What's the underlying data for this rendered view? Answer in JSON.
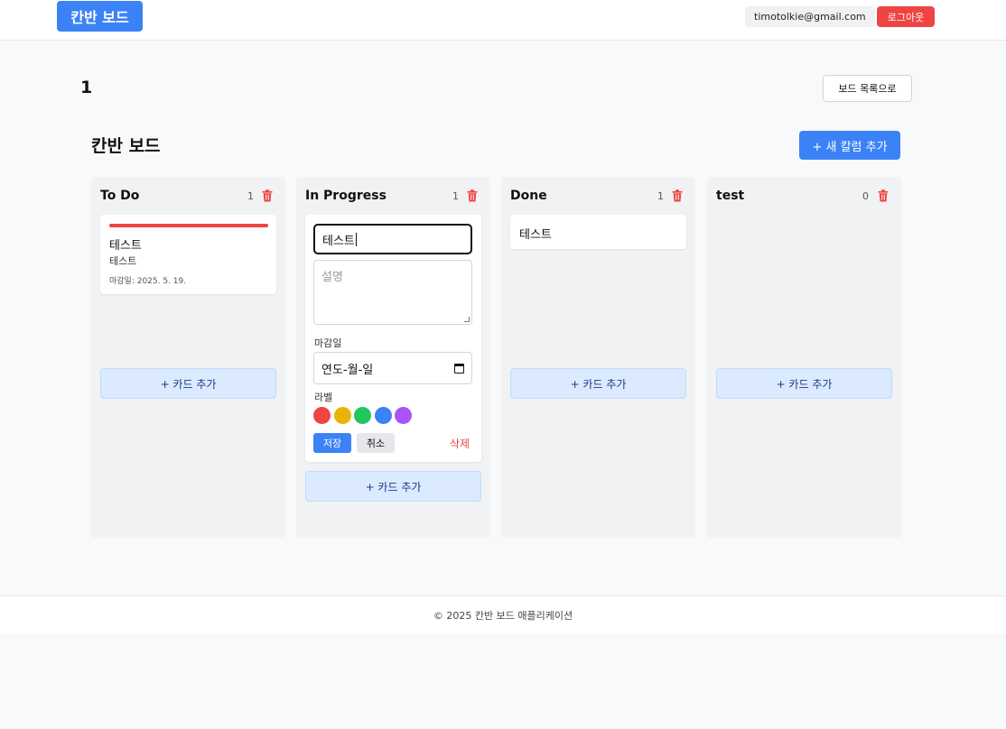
{
  "header": {
    "logo": "칸반 보드",
    "user_email": "timotolkie@gmail.com",
    "logout_label": "로그아웃"
  },
  "page": {
    "board_name": "1",
    "back_label": "보드 목록으로",
    "heading": "칸반 보드",
    "add_column_label": "+ 새 칼럼 추가"
  },
  "columns": [
    {
      "title": "To Do",
      "count": "1",
      "cards": [
        {
          "title": "테스트",
          "description": "테스트",
          "due": "마감일: 2025. 5. 19.",
          "label_color": "#ef4444"
        }
      ],
      "add_card_label": "+ 카드 추가"
    },
    {
      "title": "In Progress",
      "count": "1",
      "editor": {
        "title_value": "테스트",
        "desc_placeholder": "설명",
        "due_label": "마감일",
        "date_placeholder": "연도-월-일",
        "label_heading": "라벨",
        "label_colors": [
          "#ef4444",
          "#eab308",
          "#22c55e",
          "#3b82f6",
          "#a855f7"
        ],
        "save_label": "저장",
        "cancel_label": "취소",
        "delete_label": "삭제"
      },
      "add_card_label": "+ 카드 추가"
    },
    {
      "title": "Done",
      "count": "1",
      "cards": [
        {
          "title": "테스트"
        }
      ],
      "add_card_label": "+ 카드 추가"
    },
    {
      "title": "test",
      "count": "0",
      "add_card_label": "+ 카드 추가"
    }
  ],
  "footer": {
    "text": "© 2025 칸반 보드 애플리케이션"
  },
  "colors": {
    "accent": "#3b82f6",
    "danger": "#ef4444"
  }
}
